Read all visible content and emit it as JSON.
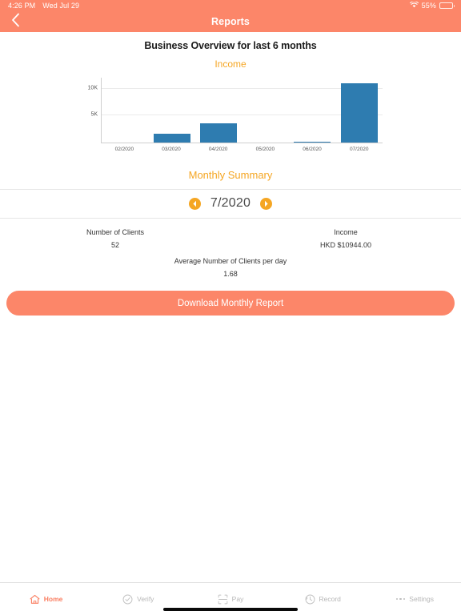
{
  "statusbar": {
    "time": "4:26 PM",
    "date": "Wed Jul 29",
    "battery_percent": "55%",
    "wifi_icon": "wifi-icon",
    "battery_icon": "battery-icon"
  },
  "navbar": {
    "title": "Reports",
    "back_icon": "chevron-left-icon",
    "background_color": "#fc8669"
  },
  "report": {
    "title": "Business Overview for last 6 months",
    "subtitle": "Income",
    "accent_color": "#f5a623"
  },
  "chart_data": {
    "type": "bar",
    "title": "Income",
    "categories": [
      "02/2020",
      "03/2020",
      "04/2020",
      "05/2020",
      "06/2020",
      "07/2020"
    ],
    "values": [
      0,
      1700,
      3500,
      0,
      200,
      10944
    ],
    "ytick_labels": [
      "10K",
      "5K"
    ],
    "ytick_values": [
      10000,
      5000
    ],
    "ylim": [
      0,
      12000
    ],
    "xlabel": "",
    "ylabel": "",
    "grid": true,
    "legend": "none",
    "bar_color": "#2e7cb0",
    "series": [
      {
        "name": "Income",
        "values": [
          0,
          1700,
          3500,
          0,
          200,
          10944
        ]
      }
    ]
  },
  "summary": {
    "section_title": "Monthly Summary",
    "prev_icon": "caret-left-icon",
    "next_icon": "caret-right-icon",
    "month": "7/2020",
    "stats": [
      {
        "label": "Number of Clients",
        "value": "52"
      },
      {
        "label": "Income",
        "value": "HKD $10944.00"
      }
    ],
    "average": {
      "label": "Average Number of Clients per day",
      "value": "1.68"
    }
  },
  "actions": {
    "download_label": "Download Monthly Report"
  },
  "tabbar": {
    "items": [
      {
        "label": "Home",
        "icon": "home-icon",
        "active": true
      },
      {
        "label": "Verify",
        "icon": "check-circle-icon",
        "active": false
      },
      {
        "label": "Pay",
        "icon": "scan-icon",
        "active": false
      },
      {
        "label": "Record",
        "icon": "clock-history-icon",
        "active": false
      },
      {
        "label": "Settings",
        "icon": "ellipsis-icon",
        "active": false
      }
    ],
    "active_color": "#fa7e61",
    "inactive_color": "#b6b6b6"
  }
}
